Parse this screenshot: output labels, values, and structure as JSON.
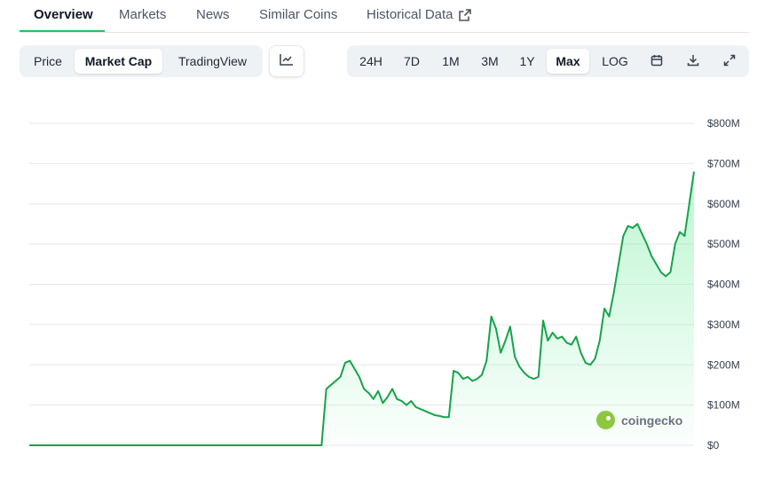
{
  "tabs": [
    {
      "label": "Overview",
      "active": true
    },
    {
      "label": "Markets"
    },
    {
      "label": "News"
    },
    {
      "label": "Similar Coins"
    },
    {
      "label": "Historical Data",
      "icon": "external-link-icon"
    }
  ],
  "view_toggle": [
    "Price",
    "Market Cap",
    "TradingView"
  ],
  "view_active": "Market Cap",
  "chart_type_icon": "line-chart-icon",
  "ranges": [
    "24H",
    "7D",
    "1M",
    "3M",
    "1Y",
    "Max",
    "LOG"
  ],
  "range_active": "Max",
  "toolbar_icons": [
    "calendar-icon",
    "download-icon",
    "expand-icon"
  ],
  "watermark": "coingecko",
  "colors": {
    "line": "#16a34a",
    "fill_top": "#86efac",
    "grid": "#e5e7eb",
    "accent": "#22c55e"
  },
  "chart_data": {
    "type": "area",
    "y_unit": "USD market cap",
    "y_ticks": [
      "$0",
      "$100M",
      "$200M",
      "$300M",
      "$400M",
      "$500M",
      "$600M",
      "$700M",
      "$800M"
    ],
    "ylim": [
      0,
      800000000
    ],
    "y_axis_side": "right",
    "grid": true,
    "x_labels_shown": false,
    "series": [
      {
        "values": [
          0,
          0,
          0,
          0,
          0,
          0,
          0,
          0,
          0,
          0,
          0,
          0,
          0,
          0,
          0,
          0,
          0,
          0,
          0,
          0,
          0,
          0,
          0,
          0,
          0,
          0,
          0,
          0,
          0,
          0,
          0,
          0,
          0,
          0,
          0,
          0,
          0,
          0,
          0,
          0,
          0,
          0,
          0,
          0,
          0,
          0,
          0,
          0,
          0,
          0,
          0,
          0,
          0,
          0,
          0,
          0,
          0,
          0,
          0,
          0,
          0,
          0,
          0,
          140000000,
          150000000,
          160000000,
          170000000,
          205000000,
          210000000,
          190000000,
          170000000,
          140000000,
          130000000,
          115000000,
          135000000,
          105000000,
          120000000,
          140000000,
          115000000,
          110000000,
          100000000,
          110000000,
          95000000,
          90000000,
          85000000,
          80000000,
          75000000,
          73000000,
          70000000,
          70000000,
          185000000,
          180000000,
          165000000,
          170000000,
          160000000,
          165000000,
          175000000,
          210000000,
          320000000,
          290000000,
          230000000,
          260000000,
          295000000,
          220000000,
          195000000,
          180000000,
          170000000,
          165000000,
          170000000,
          310000000,
          260000000,
          280000000,
          265000000,
          270000000,
          255000000,
          250000000,
          270000000,
          230000000,
          205000000,
          200000000,
          215000000,
          260000000,
          340000000,
          320000000,
          380000000,
          450000000,
          520000000,
          545000000,
          540000000,
          550000000,
          525000000,
          500000000,
          470000000,
          450000000,
          430000000,
          420000000,
          430000000,
          500000000,
          530000000,
          520000000,
          600000000,
          680000000
        ]
      }
    ]
  }
}
